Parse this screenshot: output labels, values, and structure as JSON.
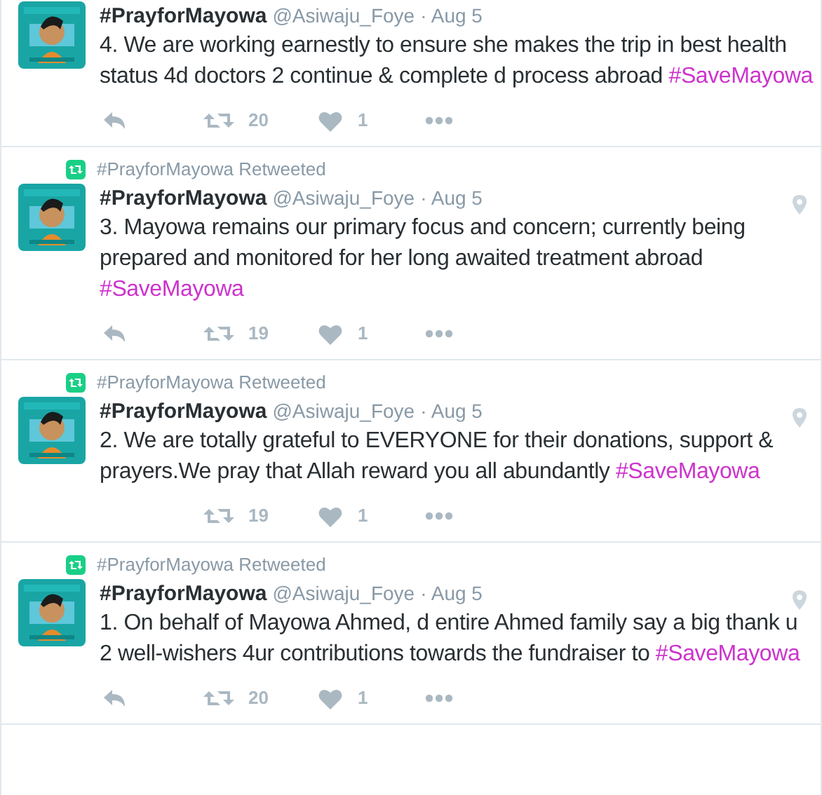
{
  "tweets": [
    {
      "name": "#PrayforMayowa",
      "handle": "@Asiwaju_Foye",
      "time": "· Aug 5",
      "pin": false,
      "body": {
        "text": "4. We are working earnestly to ensure she makes the trip in best health status 4d doctors 2 continue & complete d process abroad",
        "hashtag": "#SaveMayowa"
      },
      "actions": [
        {
          "kind": "reply"
        },
        {
          "kind": "retweet",
          "count": "20"
        },
        {
          "kind": "like",
          "count": "1"
        },
        {
          "kind": "more"
        }
      ]
    },
    {
      "retweeted_by": "#PrayforMayowa Retweeted",
      "name": "#PrayforMayowa",
      "handle": "@Asiwaju_Foye",
      "time": "· Aug 5",
      "pin": true,
      "body": {
        "text": "3. Mayowa remains our primary focus and concern; currently being prepared and monitored for her long awaited treatment abroad",
        "hashtag": "#SaveMayowa"
      },
      "actions": [
        {
          "kind": "reply"
        },
        {
          "kind": "retweet",
          "count": "19"
        },
        {
          "kind": "like",
          "count": "1"
        },
        {
          "kind": "more"
        }
      ]
    },
    {
      "retweeted_by": "#PrayforMayowa Retweeted",
      "name": "#PrayforMayowa",
      "handle": "@Asiwaju_Foye",
      "time": "· Aug 5",
      "pin": true,
      "body": {
        "text": "2. We are totally grateful to EVERYONE for their donations, support & prayers.We pray that Allah reward you all abundantly",
        "hashtag": "#SaveMayowa"
      },
      "actions": [
        {
          "kind": "retweet",
          "count": "19"
        },
        {
          "kind": "like",
          "count": "1"
        },
        {
          "kind": "more"
        }
      ]
    },
    {
      "retweeted_by": "#PrayforMayowa Retweeted",
      "name": "#PrayforMayowa",
      "handle": "@Asiwaju_Foye",
      "time": "· Aug 5",
      "pin": true,
      "body": {
        "text": "1. On behalf of Mayowa Ahmed, d entire Ahmed family say a big thank u 2 well-wishers 4ur contributions towards the fundraiser to",
        "hashtag": "#SaveMayowa"
      },
      "actions": [
        {
          "kind": "reply"
        },
        {
          "kind": "retweet",
          "count": "20"
        },
        {
          "kind": "like",
          "count": "1"
        },
        {
          "kind": "more"
        }
      ]
    }
  ]
}
